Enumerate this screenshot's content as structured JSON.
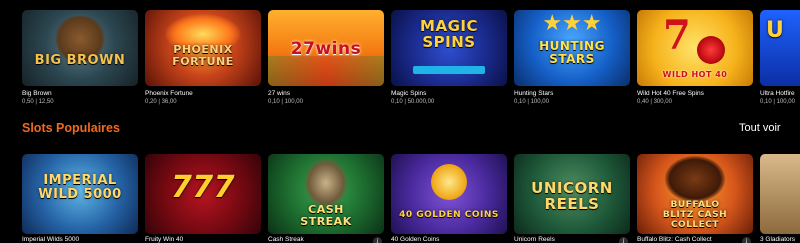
{
  "top_row": [
    {
      "name": "Big Brown",
      "bets": "0,50 | 12,50",
      "art_text": "BIG BROWN",
      "art_color": "#f2c14e"
    },
    {
      "name": "Phoenix Fortune",
      "bets": "0,20 | 36,00",
      "art_text": "PHOENIX FORTUNE",
      "art_color": "#ffd27a"
    },
    {
      "name": "27 wins",
      "bets": "0,10 | 100,00",
      "art_text": "27wins",
      "art_color": "#c8101e"
    },
    {
      "name": "Magic Spins",
      "bets": "0,10 | 50.000,00",
      "art_text": "MAGIC SPINS",
      "art_color": "#ffd23a"
    },
    {
      "name": "Hunting Stars",
      "bets": "0,10 | 100,00",
      "art_text": "HUNTING STARS",
      "art_color": "#ffe14a"
    },
    {
      "name": "Wild Hot 40 Free Spins",
      "bets": "0,40 | 300,00",
      "art_text": "WILD HOT 40",
      "art_color": "#d0101a"
    },
    {
      "name": "Ultra Hotfire",
      "bets": "0,10 | 100,00",
      "art_text": "U",
      "art_color": "#ffd23a"
    }
  ],
  "section": {
    "title": "Slots Populaires",
    "see_all": "Tout voir"
  },
  "bottom_row": [
    {
      "name": "Imperial Wilds 5000",
      "art_text": "IMPERIAL WILD 5000",
      "art_color": "#ffd86a",
      "info": "i"
    },
    {
      "name": "Fruity Win 40",
      "art_text": "777",
      "art_color": "#ffcf2e",
      "info": ""
    },
    {
      "name": "Cash Streak",
      "art_text": "CASH STREAK",
      "art_color": "#ffe07a",
      "info": "i"
    },
    {
      "name": "40 Golden Coins",
      "art_text": "40 GOLDEN COINS",
      "art_color": "#ffd23a",
      "info": ""
    },
    {
      "name": "Unicorn Reels",
      "art_text": "UNICORN REELS",
      "art_color": "#ffd86a",
      "info": "i"
    },
    {
      "name": "Buffalo Blitz: Cash Collect",
      "art_text": "BUFFALO BLITZ CASH COLLECT",
      "art_color": "#ffe07a",
      "info": "i"
    },
    {
      "name": "3 Gladiators",
      "art_text": "",
      "art_color": "#ffffff",
      "info": ""
    }
  ]
}
